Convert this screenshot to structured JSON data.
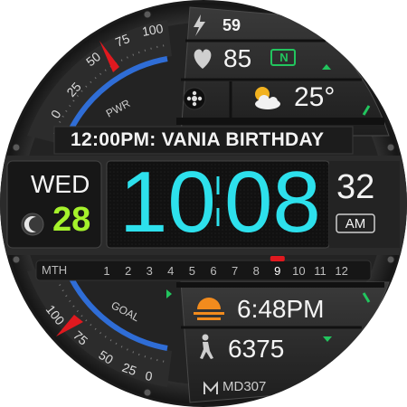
{
  "status": {
    "power_value": "59",
    "heart_rate": "85",
    "heart_zone_badge": "N",
    "weather_temp": "25°"
  },
  "event": {
    "text": "12:00PM: VANIA BIRTHDAY"
  },
  "date": {
    "weekday": "WED",
    "day": "28"
  },
  "time": {
    "hours": "10",
    "minutes": "08",
    "seconds": "32",
    "ampm": "AM"
  },
  "month_scale": {
    "label": "MTH",
    "months": [
      "1",
      "2",
      "3",
      "4",
      "5",
      "6",
      "7",
      "8",
      "9",
      "10",
      "11",
      "12"
    ],
    "current_index": 8
  },
  "sunset": {
    "time": "6:48PM"
  },
  "steps": {
    "count": "6375"
  },
  "gauges": {
    "power_label": "PWR",
    "power_ticks": [
      "0",
      "25",
      "50",
      "75",
      "100"
    ],
    "goal_label": "GOAL",
    "goal_ticks": [
      "100",
      "75",
      "50",
      "25",
      "0"
    ],
    "needle_color": "#e0191f",
    "arc_color": "#2f6dd6"
  },
  "brand": {
    "code": "MD307"
  },
  "colors": {
    "accent_cyan": "#2de0ec",
    "accent_lime": "#a5f22b",
    "accent_green": "#22c55e",
    "month_marker": "#e0191f"
  },
  "icons": [
    "bolt-icon",
    "heart-icon",
    "settings-icon",
    "partly-cloudy-icon",
    "moon-phase-icon",
    "sunset-icon",
    "walking-icon",
    "brand-logo-icon"
  ]
}
